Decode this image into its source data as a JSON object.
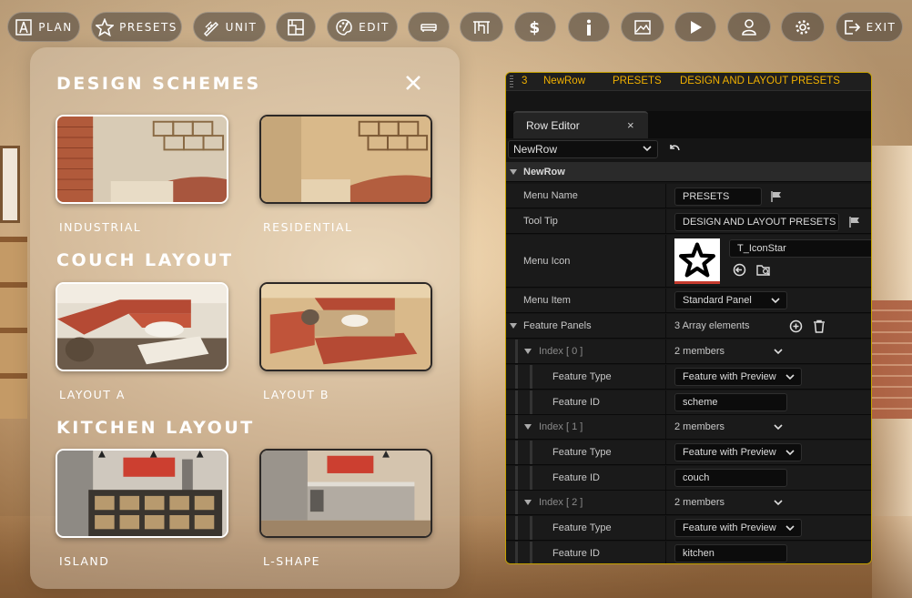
{
  "toolbar": {
    "buttons": [
      {
        "label": "PLAN",
        "icon": "compass-icon"
      },
      {
        "label": "PRESETS",
        "icon": "star-icon"
      },
      {
        "label": "UNIT",
        "icon": "ruler-pencil-icon"
      },
      {
        "label": "",
        "icon": "floorplan-icon"
      },
      {
        "label": "EDIT",
        "icon": "palette-icon"
      },
      {
        "label": "",
        "icon": "sofa-icon"
      },
      {
        "label": "",
        "icon": "table-icon"
      },
      {
        "label": "",
        "icon": "dollar-icon"
      },
      {
        "label": "",
        "icon": "info-icon"
      },
      {
        "label": "",
        "icon": "image-icon"
      },
      {
        "label": "",
        "icon": "play-icon"
      },
      {
        "label": "",
        "icon": "user-icon"
      },
      {
        "label": "",
        "icon": "gear-icon"
      },
      {
        "label": "EXIT",
        "icon": "exit-icon"
      }
    ]
  },
  "schemes": {
    "sections": [
      {
        "title": "DESIGN SCHEMES",
        "items": [
          {
            "label": "INDUSTRIAL"
          },
          {
            "label": "RESIDENTIAL"
          }
        ]
      },
      {
        "title": "COUCH LAYOUT",
        "items": [
          {
            "label": "LAYOUT A"
          },
          {
            "label": "LAYOUT B"
          }
        ]
      },
      {
        "title": "KITCHEN LAYOUT",
        "items": [
          {
            "label": "ISLAND"
          },
          {
            "label": "L-SHAPE"
          }
        ]
      }
    ]
  },
  "editor": {
    "breadcrumb": {
      "index": "3",
      "row": "NewRow",
      "menu": "PRESETS",
      "tooltip": "DESIGN AND LAYOUT PRESETS"
    },
    "tab_label": "Row Editor",
    "tab_close": "×",
    "row_select": "NewRow",
    "group_name": "NewRow",
    "menu_name": {
      "label": "Menu Name",
      "value": "PRESETS"
    },
    "tool_tip": {
      "label": "Tool Tip",
      "value": "DESIGN AND LAYOUT PRESETS"
    },
    "menu_icon": {
      "label": "Menu Icon",
      "value": "T_IconStar"
    },
    "menu_item": {
      "label": "Menu Item",
      "value": "Standard Panel"
    },
    "feature_panels": {
      "label": "Feature Panels",
      "summary": "3 Array elements"
    },
    "elements": [
      {
        "index": "Index [ 0 ]",
        "members": "2 members",
        "type_label": "Feature Type",
        "type_value": "Feature with Preview",
        "id_label": "Feature ID",
        "id_value": "scheme"
      },
      {
        "index": "Index [ 1 ]",
        "members": "2 members",
        "type_label": "Feature Type",
        "type_value": "Feature with Preview",
        "id_label": "Feature ID",
        "id_value": "couch"
      },
      {
        "index": "Index [ 2 ]",
        "members": "2 members",
        "type_label": "Feature Type",
        "type_value": "Feature with Preview",
        "id_label": "Feature ID",
        "id_value": "kitchen"
      }
    ]
  }
}
